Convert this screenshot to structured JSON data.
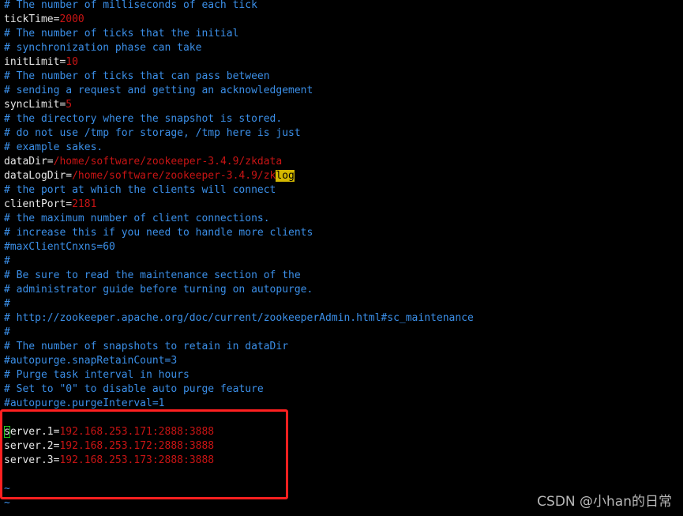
{
  "colors": {
    "comment": "#3b8fe8",
    "text": "#e6e6e6",
    "value": "#c81414",
    "search_highlight": "#d4b800",
    "annotation_box": "#ff2020",
    "cursor": "#1ec81e"
  },
  "lines": [
    [
      {
        "t": "# The number of milliseconds of each tick",
        "c": "comment"
      }
    ],
    [
      {
        "t": "tickTime=",
        "c": "text"
      },
      {
        "t": "2000",
        "c": "value"
      }
    ],
    [
      {
        "t": "# The number of ticks that the initial",
        "c": "comment"
      }
    ],
    [
      {
        "t": "# synchronization phase can take",
        "c": "comment"
      }
    ],
    [
      {
        "t": "initLimit=",
        "c": "text"
      },
      {
        "t": "10",
        "c": "value"
      }
    ],
    [
      {
        "t": "# The number of ticks that can pass between",
        "c": "comment"
      }
    ],
    [
      {
        "t": "# sending a request and getting an acknowledgement",
        "c": "comment"
      }
    ],
    [
      {
        "t": "syncLimit=",
        "c": "text"
      },
      {
        "t": "5",
        "c": "value"
      }
    ],
    [
      {
        "t": "# the directory where the snapshot is stored.",
        "c": "comment"
      }
    ],
    [
      {
        "t": "# do not use /tmp for storage, /tmp here is just",
        "c": "comment"
      }
    ],
    [
      {
        "t": "# example sakes.",
        "c": "comment"
      }
    ],
    [
      {
        "t": "dataDir=",
        "c": "text"
      },
      {
        "t": "/home/software/zookeeper-3.4.9/zkdata",
        "c": "value"
      }
    ],
    [
      {
        "t": "dataLogDir=",
        "c": "text"
      },
      {
        "t": "/home/software/zookeeper-3.4.9/zk",
        "c": "value"
      },
      {
        "t": "log",
        "c": "search"
      }
    ],
    [
      {
        "t": "# the port at which the clients will connect",
        "c": "comment"
      }
    ],
    [
      {
        "t": "clientPort=",
        "c": "text"
      },
      {
        "t": "2181",
        "c": "value"
      }
    ],
    [
      {
        "t": "# the maximum number of client connections.",
        "c": "comment"
      }
    ],
    [
      {
        "t": "# increase this if you need to handle more clients",
        "c": "comment"
      }
    ],
    [
      {
        "t": "#maxClientCnxns=60",
        "c": "comment"
      }
    ],
    [
      {
        "t": "#",
        "c": "comment"
      }
    ],
    [
      {
        "t": "# Be sure to read the maintenance section of the",
        "c": "comment"
      }
    ],
    [
      {
        "t": "# administrator guide before turning on autopurge.",
        "c": "comment"
      }
    ],
    [
      {
        "t": "#",
        "c": "comment"
      }
    ],
    [
      {
        "t": "# http://zookeeper.apache.org/doc/current/zookeeperAdmin.html#sc_maintenance",
        "c": "comment"
      }
    ],
    [
      {
        "t": "#",
        "c": "comment"
      }
    ],
    [
      {
        "t": "# The number of snapshots to retain in dataDir",
        "c": "comment"
      }
    ],
    [
      {
        "t": "#autopurge.snapRetainCount=3",
        "c": "comment"
      }
    ],
    [
      {
        "t": "# Purge task interval in hours",
        "c": "comment"
      }
    ],
    [
      {
        "t": "# Set to \"0\" to disable auto purge feature",
        "c": "comment"
      }
    ],
    [
      {
        "t": "#autopurge.purgeInterval=1",
        "c": "comment"
      }
    ],
    [],
    [
      {
        "t": "s",
        "c": "text cursor"
      },
      {
        "t": "erver.1=",
        "c": "text"
      },
      {
        "t": "192.168.253.171:2888:3888",
        "c": "value"
      }
    ],
    [
      {
        "t": "server.2=",
        "c": "text"
      },
      {
        "t": "192.168.253.172:2888:3888",
        "c": "value"
      }
    ],
    [
      {
        "t": "server.3=",
        "c": "text"
      },
      {
        "t": "192.168.253.173:2888:3888",
        "c": "value"
      }
    ],
    [],
    [
      {
        "t": "~",
        "c": "tilde"
      }
    ],
    [
      {
        "t": "~",
        "c": "tilde"
      }
    ]
  ],
  "watermark": "CSDN @小han的日常"
}
